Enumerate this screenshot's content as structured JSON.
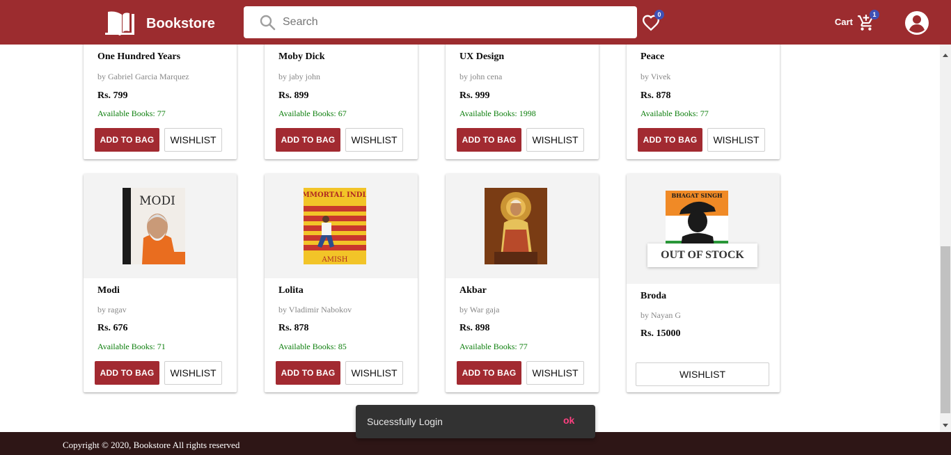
{
  "app": {
    "name": "Bookstore"
  },
  "search": {
    "placeholder": "Search"
  },
  "wishlist": {
    "count": "0"
  },
  "cart": {
    "label": "Cart",
    "count": "1"
  },
  "labels": {
    "add_to_bag": "ADD TO BAG",
    "wishlist": "WISHLIST",
    "out_of_stock": "OUT OF STOCK"
  },
  "books_row1": [
    {
      "title": "One Hundred Years",
      "author": "by Gabriel Garcia Marquez",
      "price": "Rs. 799",
      "available": "Available Books: 77"
    },
    {
      "title": "Moby Dick",
      "author": "by jaby john",
      "price": "Rs. 899",
      "available": "Available Books: 67"
    },
    {
      "title": "UX Design",
      "author": "by john cena",
      "price": "Rs. 999",
      "available": "Available Books: 1998"
    },
    {
      "title": "Peace",
      "author": "by Vivek",
      "price": "Rs. 878",
      "available": "Available Books: 77"
    }
  ],
  "books_row2": [
    {
      "title": "Modi",
      "author": "by ragav",
      "price": "Rs. 676",
      "available": "Available Books: 71",
      "cover_text": "MODI"
    },
    {
      "title": "Lolita",
      "author": "by Vladimir Nabokov",
      "price": "Rs. 878",
      "available": "Available Books: 85",
      "cover_text": "IMMORTAL INDIA",
      "cover_text2": "AMISH"
    },
    {
      "title": "Akbar",
      "author": "by War gaja",
      "price": "Rs. 898",
      "available": "Available Books: 77"
    },
    {
      "title": "Broda",
      "author": "by Nayan G",
      "price": "Rs. 15000",
      "cover_text": "BHAGAT SINGH"
    }
  ],
  "footer": {
    "text": "Copyright © 2020, Bookstore All rights reserved"
  },
  "snackbar": {
    "message": "Sucessfully Login",
    "action": "ok"
  },
  "colors": {
    "header": "#9c2c2f",
    "button": "#a22a31",
    "available": "#0a7d0a",
    "footer": "#2e1616",
    "badge": "#3f51b5",
    "snack_action": "#ff4081"
  }
}
